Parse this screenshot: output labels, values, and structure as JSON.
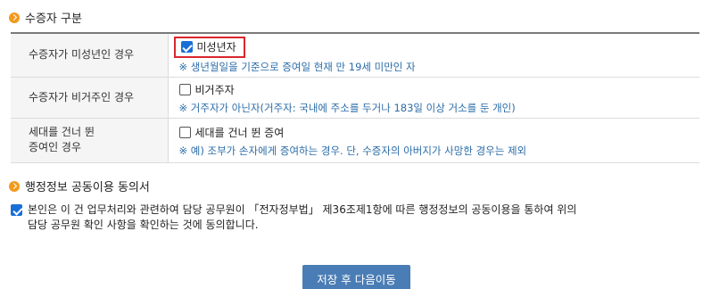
{
  "section1": {
    "title": "수증자 구분"
  },
  "rows": [
    {
      "label": "수증자가 미성년인 경우",
      "option": "미성년자",
      "checked": true,
      "note": "※ 생년월일을 기준으로 증여일 현재 만 19세 미만인 자"
    },
    {
      "label": "수증자가 비거주인 경우",
      "option": "비거주자",
      "checked": false,
      "note": "※ 거주자가 아닌자(거주자: 국내에 주소를 두거나 183일 이상 거소를 둔 개인)"
    },
    {
      "label_line1": "세대를 건너 뛴",
      "label_line2": "증여인 경우",
      "option": "세대를 건너 뛴 증여",
      "checked": false,
      "note": "※ 예) 조부가 손자에게 증여하는 경우. 단, 수증자의 아버지가 사망한 경우는 제외"
    }
  ],
  "section2": {
    "title": "행정정보 공동이용 동의서",
    "agree_checked": true,
    "agree_line1": "본인은 이 건 업무처리와 관련하여 담당 공무원이 「전자정부법」 제36조제1항에 따른 행정정보의 공동이용을 통하여 위의",
    "agree_line2": "담당 공무원 확인 사항을 확인하는 것에 동의합니다."
  },
  "submit_label": "저장 후 다음이동"
}
